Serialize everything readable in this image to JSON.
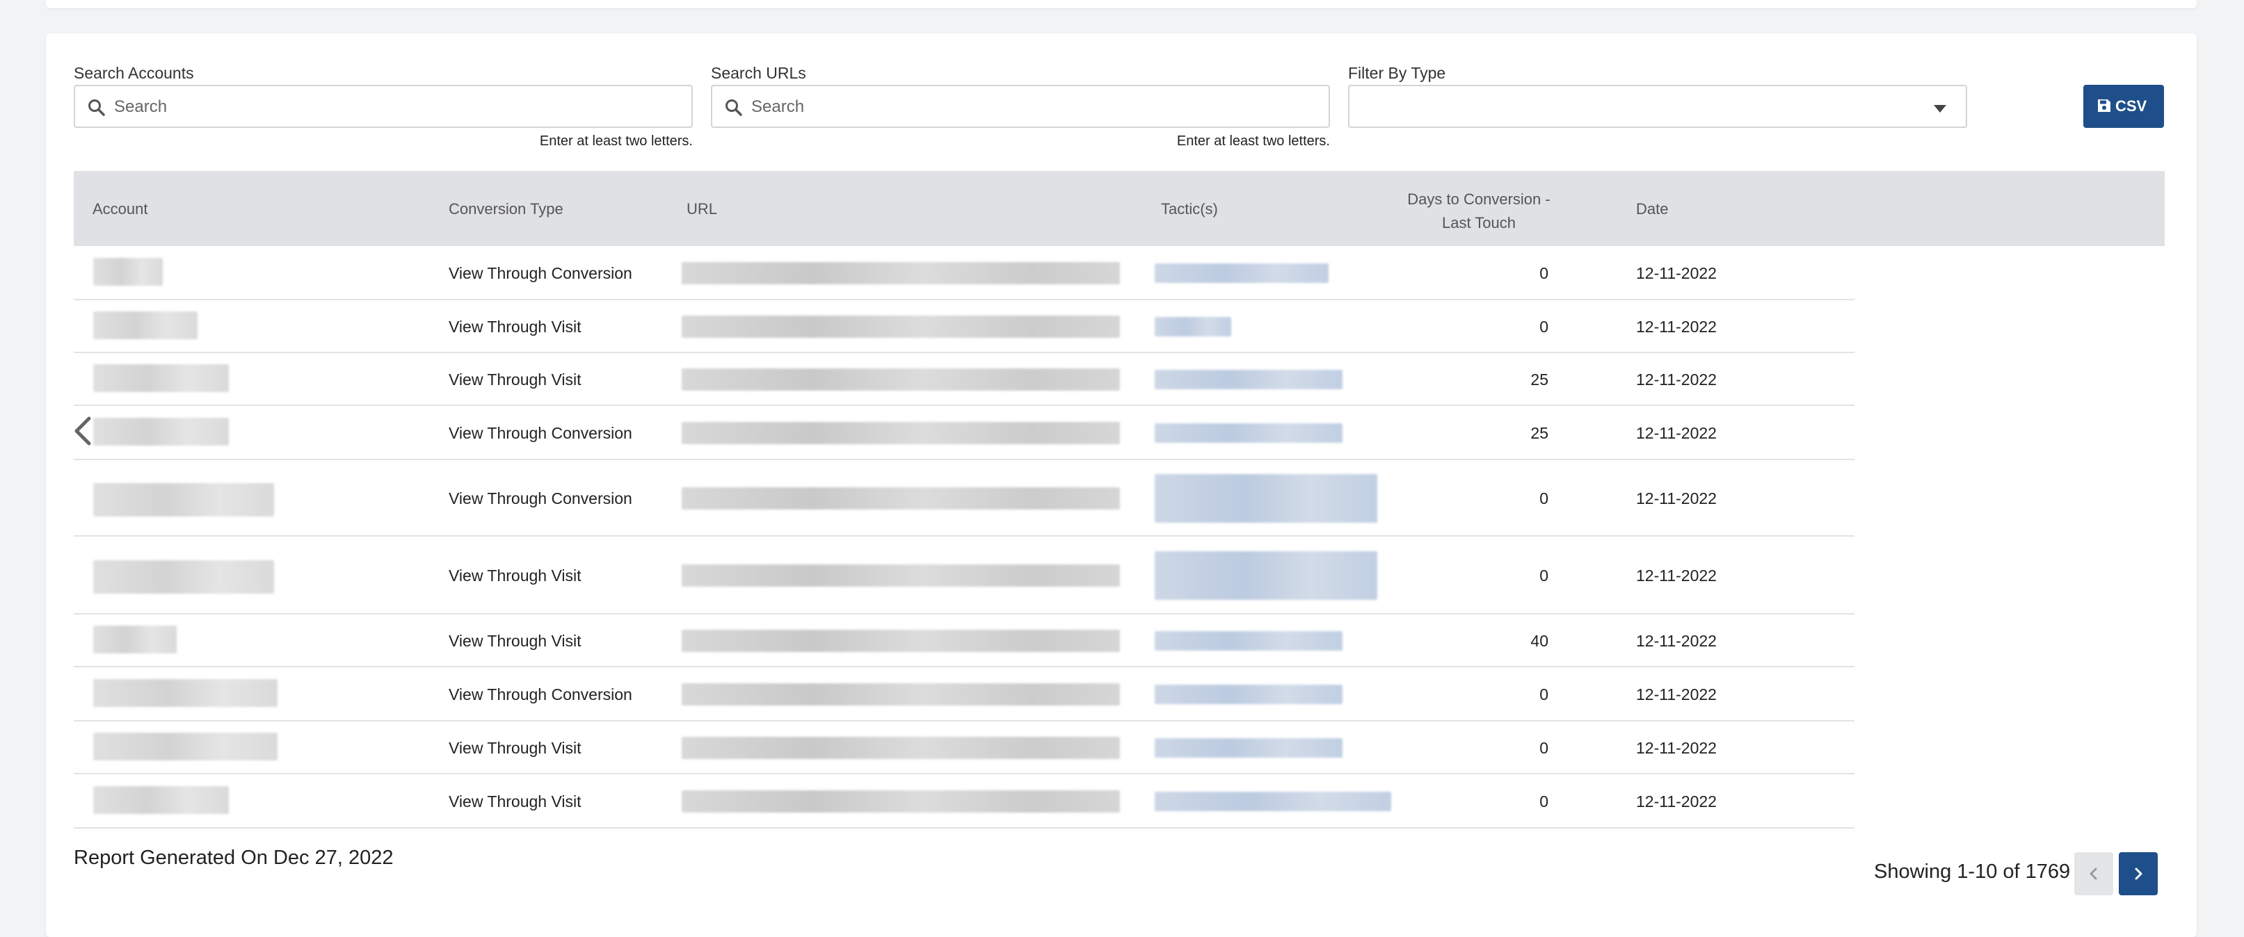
{
  "filters": {
    "accounts": {
      "label": "Search Accounts",
      "placeholder": "Search",
      "hint": "Enter at least two letters."
    },
    "urls": {
      "label": "Search URLs",
      "placeholder": "Search",
      "hint": "Enter at least two letters."
    },
    "type": {
      "label": "Filter By Type",
      "value": ""
    }
  },
  "csv_button": {
    "label": "CSV",
    "icon": "save-icon"
  },
  "table": {
    "columns": [
      "Account",
      "Conversion Type",
      "URL",
      "Tactic(s)",
      "Days to Conversion -\nLast Touch",
      "Date"
    ],
    "rows": [
      {
        "conversion_type": "View Through Conversion",
        "days": "0",
        "date": "12-11-2022"
      },
      {
        "conversion_type": "View Through Visit",
        "days": "0",
        "date": "12-11-2022"
      },
      {
        "conversion_type": "View Through Visit",
        "days": "25",
        "date": "12-11-2022"
      },
      {
        "conversion_type": "View Through Conversion",
        "days": "25",
        "date": "12-11-2022"
      },
      {
        "conversion_type": "View Through Conversion",
        "days": "0",
        "date": "12-11-2022"
      },
      {
        "conversion_type": "View Through Visit",
        "days": "0",
        "date": "12-11-2022"
      },
      {
        "conversion_type": "View Through Visit",
        "days": "40",
        "date": "12-11-2022"
      },
      {
        "conversion_type": "View Through Conversion",
        "days": "0",
        "date": "12-11-2022"
      },
      {
        "conversion_type": "View Through Visit",
        "days": "0",
        "date": "12-11-2022"
      },
      {
        "conversion_type": "View Through Visit",
        "days": "0",
        "date": "12-11-2022"
      }
    ]
  },
  "footer": {
    "report_generated": "Report Generated On Dec 27, 2022",
    "showing": "Showing 1-10 of 1769"
  },
  "colors": {
    "primary": "#1f4f8a",
    "header_bg": "#dfe1e4"
  }
}
